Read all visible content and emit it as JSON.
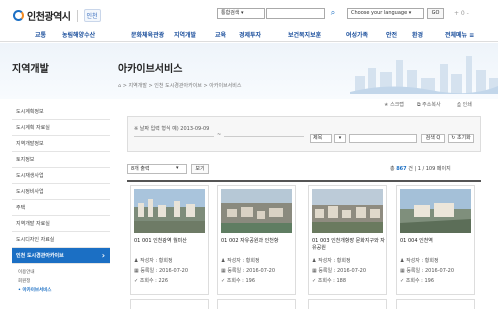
{
  "header": {
    "logo_text": "인천광역시",
    "badge_text": "인천",
    "search_scope": "통합검색",
    "language_select": "Choose your language",
    "go_label": "GO",
    "zoom_text": "+ 0 -"
  },
  "nav": [
    "교통",
    "농림해양수산",
    "문화체육관광",
    "지역개발",
    "교육",
    "경제투자",
    "보건복지보훈",
    "여성가족",
    "안전",
    "환경",
    "전체메뉴"
  ],
  "sidebar": {
    "title": "지역개발",
    "items": [
      "도시계획정보",
      "도시계획 자료실",
      "지역개발정보",
      "토지정보",
      "도시재생사업",
      "도시정비사업",
      "주택",
      "지역개발 자료실",
      "도시디자인 자료실",
      "인천 도시경관아카이브"
    ],
    "sub_items": [
      "이용안내",
      "회원정",
      "아카이브서비스"
    ]
  },
  "page": {
    "title": "아카이브서비스",
    "breadcrumb": "⌂ > 지역개발 > 인천 도시경관아카이브 > 아카이브서비스",
    "util": [
      "스크랩",
      "주소복사",
      "인쇄"
    ]
  },
  "filter": {
    "date_label": "※ 날짜 입력 형식 예) 2013-09-09",
    "tilde": "~",
    "cond_value": "제목",
    "search_label": "검색 Q",
    "reset_label": "초기화"
  },
  "list": {
    "per_page": "8개 출력",
    "view_label": "보기",
    "count_total": "867",
    "count_suffix": " 건 | 1 / 109 페이지"
  },
  "cards": [
    {
      "title": "01 001 인천광역 월미산",
      "author": "작성자 : 황희정",
      "date": "등록일 : 2016-07-20",
      "views": "조회수 : 226"
    },
    {
      "title": "01 002 자유공원과 인천항",
      "author": "작성자 : 황희정",
      "date": "등록일 : 2016-07-20",
      "views": "조회수 : 196"
    },
    {
      "title": "01 003 인천개항장 문화지구와 자유공원",
      "author": "작성자 : 황희정",
      "date": "등록일 : 2016-07-20",
      "views": "조회수 : 188"
    },
    {
      "title": "01 004 인천역",
      "author": "작성자 : 황희정",
      "date": "등록일 : 2016-07-20",
      "views": "조회수 : 196"
    }
  ]
}
